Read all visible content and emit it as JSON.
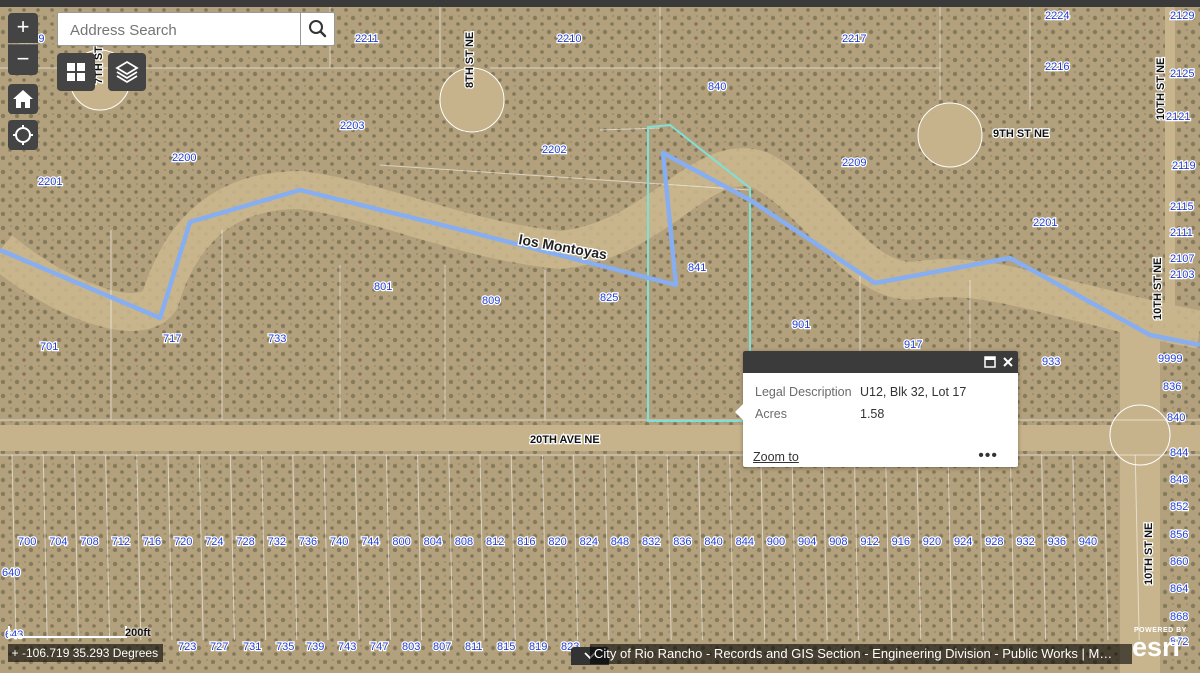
{
  "search": {
    "placeholder": "Address Search"
  },
  "controls": {
    "zoom_in": "+",
    "zoom_out": "−",
    "basemap_gallery_icon": "grid-icon",
    "layers_icon": "layers-icon",
    "home_icon": "home-icon",
    "locate_icon": "locate-icon"
  },
  "map": {
    "arroyo_name": "los Montoyas",
    "streets": [
      "8TH ST NE",
      "9TH ST NE",
      "10TH ST NE",
      "10TH ST NE",
      "20TH AVE NE",
      "7TH ST"
    ],
    "parcels_top": [
      "2209",
      "2211",
      "2210",
      "2217",
      "2224",
      "2129",
      "2125",
      "2121",
      "2216",
      "840",
      "2203",
      "2202",
      "2200",
      "2201",
      "2209",
      "2119",
      "2115",
      "2111",
      "2107",
      "2103",
      "2201",
      "841",
      "801",
      "809",
      "825",
      "901",
      "917",
      "933",
      "717",
      "733",
      "701",
      "9999",
      "836",
      "840",
      "844",
      "848",
      "852",
      "856",
      "860",
      "864",
      "868",
      "872"
    ],
    "parcels_row": [
      "700",
      "704",
      "708",
      "712",
      "716",
      "720",
      "724",
      "728",
      "732",
      "736",
      "740",
      "744",
      "800",
      "804",
      "808",
      "812",
      "816",
      "820",
      "824",
      "848",
      "832",
      "836",
      "840",
      "844",
      "900",
      "904",
      "908",
      "912",
      "916",
      "920",
      "924",
      "928",
      "932",
      "936",
      "940"
    ],
    "parcels_bottom": [
      "643",
      "723",
      "727",
      "731",
      "735",
      "739",
      "743",
      "747",
      "803",
      "807",
      "811",
      "815",
      "819",
      "823"
    ],
    "left_edge": "640",
    "selected_color": "#7fe0d8",
    "arroyo_color": "#86aef0"
  },
  "popup": {
    "rows": [
      {
        "label": "Legal Description",
        "value": "U12, Blk 32, Lot 17"
      },
      {
        "label": "Acres",
        "value": "1.58"
      }
    ],
    "zoom_to": "Zoom to",
    "more": "•••"
  },
  "footer": {
    "coordinates": "-106.719 35.293 Degrees",
    "scale": "200ft",
    "attribution": "City of Rio Rancho - Records and GIS Section - Engineering Division - Public Works | M…",
    "powered_by": "POWERED BY",
    "esri": "esri"
  }
}
